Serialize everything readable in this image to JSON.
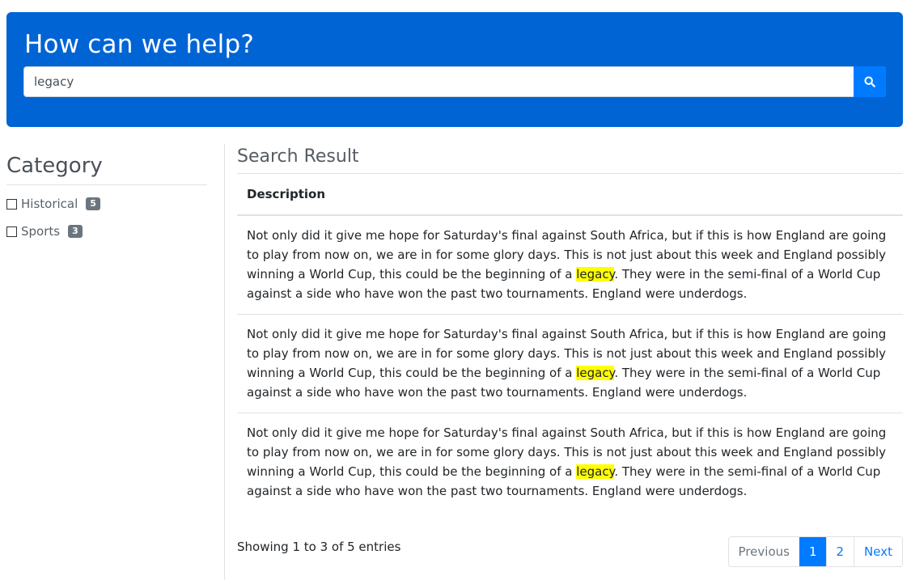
{
  "header": {
    "title": "How can we help?",
    "search_value": "legacy",
    "search_button_icon": "search-icon"
  },
  "sidebar": {
    "title": "Category",
    "items": [
      {
        "label": "Historical",
        "count": "5"
      },
      {
        "label": "Sports",
        "count": "3"
      }
    ]
  },
  "main": {
    "title": "Search Result",
    "column_header": "Description",
    "highlight_color": "#ffff00",
    "rows": [
      {
        "before": "Not only did it give me hope for Saturday's final against South Africa, but if this is how England are going to play from now on, we are in for some glory days. This is not just about this week and England possibly winning a World Cup, this could be the beginning of a ",
        "highlight": "legacy",
        "after": ". They were in the semi-final of a World Cup against a side who have won the past two tournaments. England were underdogs."
      },
      {
        "before": "Not only did it give me hope for Saturday's final against South Africa, but if this is how England are going to play from now on, we are in for some glory days. This is not just about this week and England possibly winning a World Cup, this could be the beginning of a ",
        "highlight": "legacy",
        "after": ". They were in the semi-final of a World Cup against a side who have won the past two tournaments. England were underdogs."
      },
      {
        "before": "Not only did it give me hope for Saturday's final against South Africa, but if this is how England are going to play from now on, we are in for some glory days. This is not just about this week and England possibly winning a World Cup, this could be the beginning of a ",
        "highlight": "legacy",
        "after": ". They were in the semi-final of a World Cup against a side who have won the past two tournaments. England were underdogs."
      }
    ]
  },
  "footer": {
    "showing": "Showing 1 to 3 of 5 entries",
    "pagination": {
      "previous": "Previous",
      "pages": [
        "1",
        "2"
      ],
      "active_page": "1",
      "next": "Next"
    }
  },
  "colors": {
    "hero_bg": "#0164d5",
    "primary": "#007bff",
    "badge": "#6c757d"
  }
}
